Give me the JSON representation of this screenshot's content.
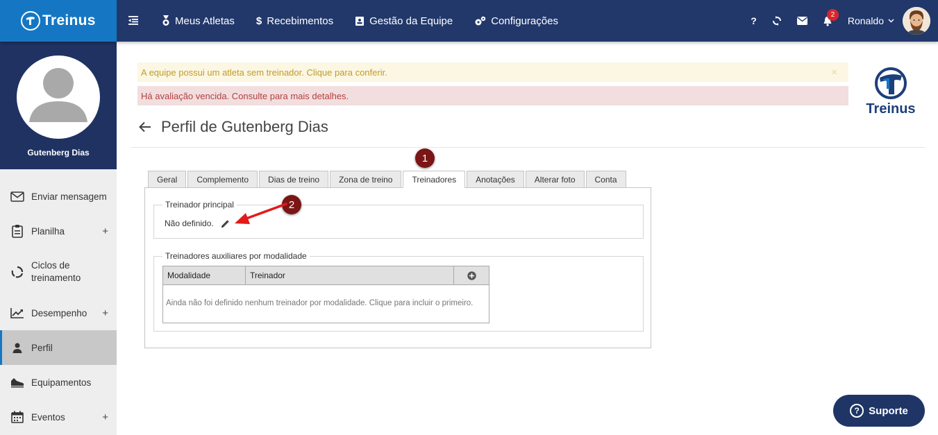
{
  "brand": {
    "name": "Treinus"
  },
  "nav": {
    "items": [
      {
        "label": "Meus Atletas",
        "icon": "medal-icon"
      },
      {
        "label": "Recebimentos",
        "icon": "dollar-icon"
      },
      {
        "label": "Gestão da Equipe",
        "icon": "id-card-icon"
      },
      {
        "label": "Configurações",
        "icon": "gears-icon"
      }
    ],
    "help": "?",
    "notifications_count": "2",
    "user_name": "Ronaldo"
  },
  "sidebar": {
    "profile_name": "Gutenberg Dias",
    "items": [
      {
        "label": "Enviar mensagem",
        "plus": ""
      },
      {
        "label": "Planilha",
        "plus": "+"
      },
      {
        "label": "Ciclos de treinamento",
        "plus": ""
      },
      {
        "label": "Desempenho",
        "plus": "+"
      },
      {
        "label": "Perfil",
        "plus": ""
      },
      {
        "label": "Equipamentos",
        "plus": ""
      },
      {
        "label": "Eventos",
        "plus": "+"
      }
    ]
  },
  "alerts": {
    "warning": "A equipe possui um atleta sem treinador. Clique para conferir.",
    "warning_close": "×",
    "danger": "Há avaliação vencida. Consulte para mais detalhes."
  },
  "logo_right": {
    "text": "Treinus"
  },
  "page": {
    "title": "Perfil de Gutenberg Dias"
  },
  "tabs": [
    "Geral",
    "Complemento",
    "Dias de treino",
    "Zona de treino",
    "Treinadores",
    "Anotações",
    "Alterar foto",
    "Conta"
  ],
  "active_tab": "Treinadores",
  "trainer": {
    "main_legend": "Treinador principal",
    "main_value": "Não definido.",
    "aux_legend": "Treinadores auxiliares por modalidade",
    "col_modalidade": "Modalidade",
    "col_treinador": "Treinador",
    "empty_text": "Ainda não foi definido nenhum treinador por modalidade. Clique para incluir o primeiro."
  },
  "markers": {
    "one": "1",
    "two": "2"
  },
  "support": {
    "label": "Suporte",
    "q": "?"
  },
  "colors": {
    "topbar": "#22386b",
    "brand": "#1577c4",
    "sidebar_profile": "#1f3262",
    "marker": "#7a1616",
    "arrow": "#e21a1a"
  }
}
